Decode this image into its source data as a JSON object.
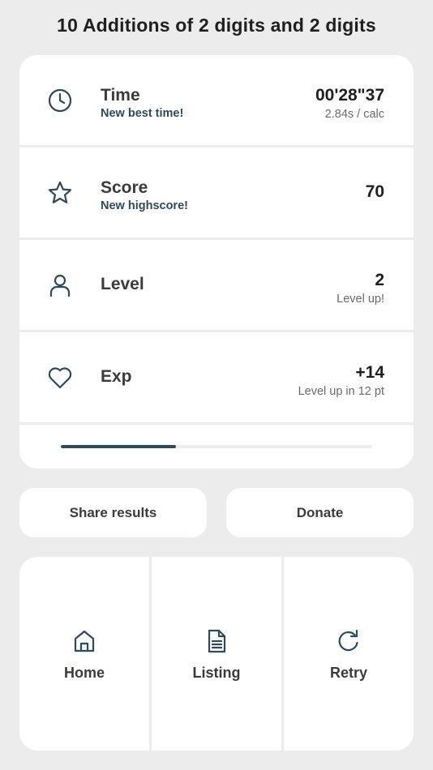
{
  "header": {
    "title": "10 Additions of 2 digits and 2 digits"
  },
  "stats": {
    "time": {
      "icon": "clock-icon",
      "label": "Time",
      "sub": "New best time!",
      "value": "00'28\"37",
      "value_sub": "2.84s / calc"
    },
    "score": {
      "icon": "star-icon",
      "label": "Score",
      "sub": "New highscore!",
      "value": "70"
    },
    "level": {
      "icon": "user-icon",
      "label": "Level",
      "value": "2",
      "value_sub": "Level up!"
    },
    "exp": {
      "icon": "heart-icon",
      "label": "Exp",
      "value": "+14",
      "value_sub": "Level up in 12 pt"
    },
    "progress": {
      "fraction": 0.37
    }
  },
  "actions": {
    "share_label": "Share results",
    "donate_label": "Donate"
  },
  "nav": {
    "home": {
      "icon": "home-icon",
      "label": "Home"
    },
    "listing": {
      "icon": "document-icon",
      "label": "Listing"
    },
    "retry": {
      "icon": "retry-icon",
      "label": "Retry"
    }
  },
  "colors": {
    "accent": "#2e4a5a",
    "background": "#ececec",
    "card": "#ffffff",
    "track": "#ededed"
  }
}
